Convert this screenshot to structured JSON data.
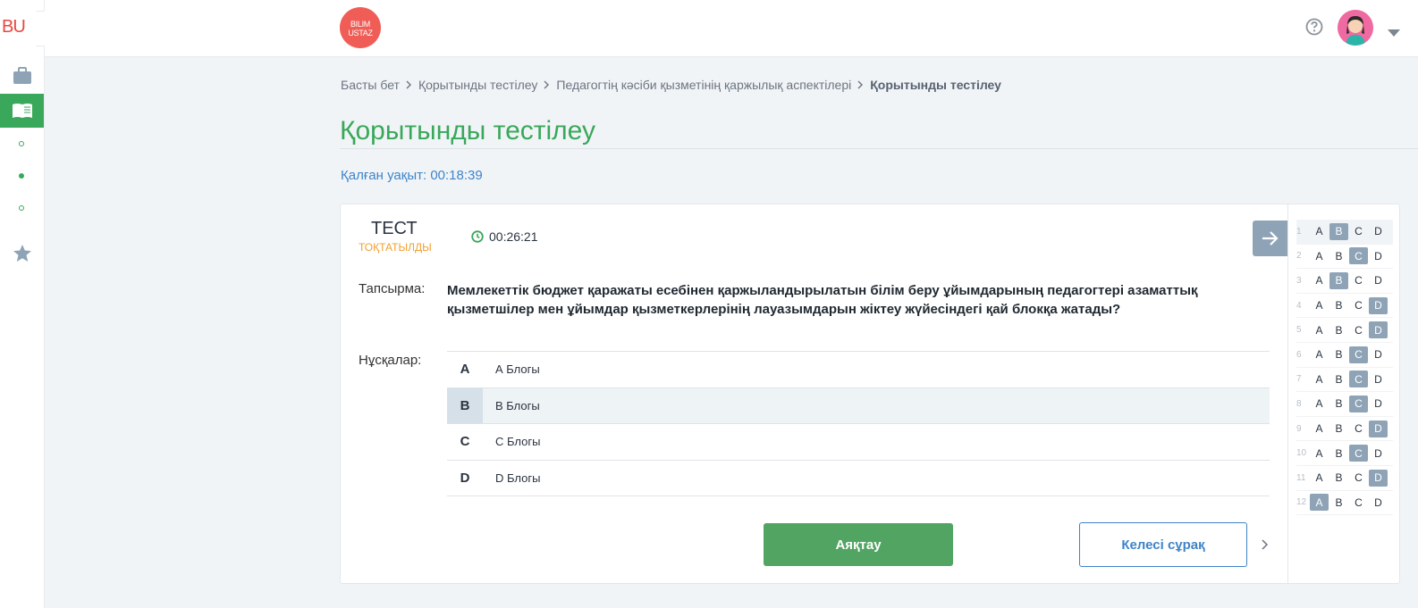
{
  "brand": {
    "short": "BU"
  },
  "logo": {
    "line1": "BILIM",
    "line2": "USTAZ"
  },
  "breadcrumb": {
    "items": [
      "Басты бет",
      "Қорытынды тестілеу",
      "Педагогтің кәсіби қызметінің қаржылық аспектілері"
    ],
    "current": "Қорытынды тестілеу"
  },
  "page": {
    "title": "Қорытынды тестілеу",
    "time_left": "Қалған уақыт: 00:18:39"
  },
  "test": {
    "title": "ТЕСТ",
    "status": "ТОҚТАТЫЛДЫ",
    "timer": "00:26:21",
    "task_label": "Тапсырма:",
    "question": "Мемлекеттік бюджет қаражаты есебінен қаржыландырылатын білім беру ұйымдарының педагогтері азаматтық қызметшілер мен ұйымдар қызметкерлерінің лауазымдарын жіктеу жүйесіндегі қай блокқа жатады?",
    "options_label": "Нұсқалар:",
    "options": [
      {
        "letter": "A",
        "text": "А Блогы",
        "selected": false
      },
      {
        "letter": "B",
        "text": "В Блогы",
        "selected": true
      },
      {
        "letter": "C",
        "text": "С Блогы",
        "selected": false
      },
      {
        "letter": "D",
        "text": "D Блогы",
        "selected": false
      }
    ],
    "finish_label": "Аяқтау",
    "next_label": "Келесі сұрақ"
  },
  "answer_sheet": {
    "letters": [
      "A",
      "B",
      "C",
      "D"
    ],
    "rows": [
      {
        "num": "1",
        "marked": "B"
      },
      {
        "num": "2",
        "marked": "C"
      },
      {
        "num": "3",
        "marked": "B"
      },
      {
        "num": "4",
        "marked": "D"
      },
      {
        "num": "5",
        "marked": "D"
      },
      {
        "num": "6",
        "marked": "C"
      },
      {
        "num": "7",
        "marked": "C"
      },
      {
        "num": "8",
        "marked": "C"
      },
      {
        "num": "9",
        "marked": "D"
      },
      {
        "num": "10",
        "marked": "C"
      },
      {
        "num": "11",
        "marked": "D"
      },
      {
        "num": "12",
        "marked": "A"
      }
    ]
  },
  "colors": {
    "accent_green": "#39a85a",
    "accent_blue": "#3f84c8",
    "status_orange": "#f0a030",
    "marked_cell": "#8fa3b6"
  }
}
